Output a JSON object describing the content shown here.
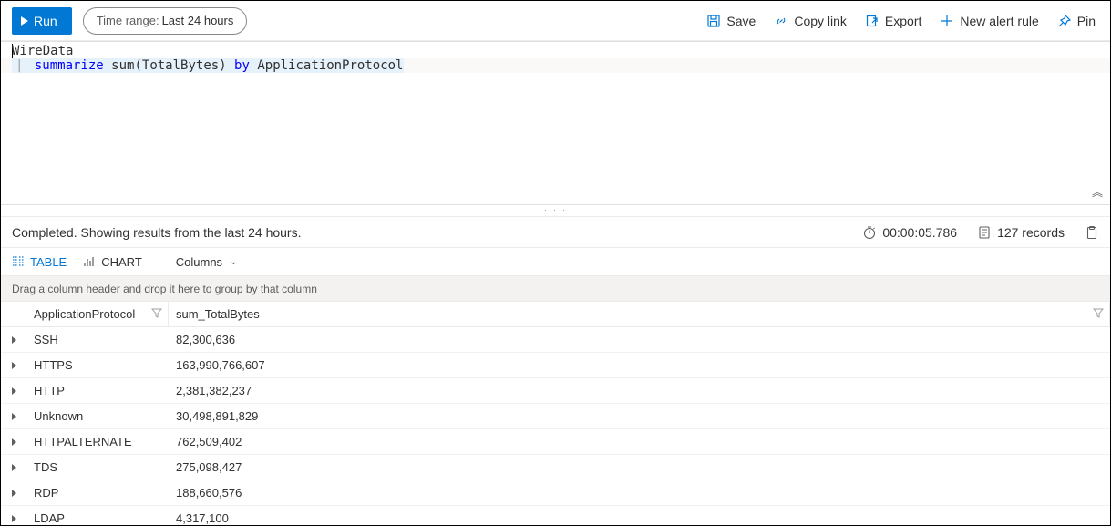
{
  "toolbar": {
    "run_label": "Run",
    "time_label": "Time range:",
    "time_value": "Last 24 hours",
    "save": "Save",
    "copylink": "Copy link",
    "export": "Export",
    "newalert": "New alert rule",
    "pin": "Pin"
  },
  "editor": {
    "line1": "WireData",
    "pipe": "|",
    "kw_summarize": "summarize",
    "fn_sum": "sum(TotalBytes)",
    "kw_by": "by",
    "ident": "ApplicationProtocol"
  },
  "splitter_dots": "· · ·",
  "collapse_glyph": "︽",
  "status": {
    "text": "Completed. Showing results from the last 24 hours.",
    "duration": "00:00:05.786",
    "records": "127 records"
  },
  "tabs": {
    "table": "TABLE",
    "chart": "CHART",
    "columns": "Columns"
  },
  "groupbar": "Drag a column header and drop it here to group by that column",
  "columns": {
    "c1": "ApplicationProtocol",
    "c2": "sum_TotalBytes"
  },
  "rows": [
    {
      "proto": "SSH",
      "bytes": "82,300,636"
    },
    {
      "proto": "HTTPS",
      "bytes": "163,990,766,607"
    },
    {
      "proto": "HTTP",
      "bytes": "2,381,382,237"
    },
    {
      "proto": "Unknown",
      "bytes": "30,498,891,829"
    },
    {
      "proto": "HTTPALTERNATE",
      "bytes": "762,509,402"
    },
    {
      "proto": "TDS",
      "bytes": "275,098,427"
    },
    {
      "proto": "RDP",
      "bytes": "188,660,576"
    },
    {
      "proto": "LDAP",
      "bytes": "4,317,100"
    }
  ]
}
